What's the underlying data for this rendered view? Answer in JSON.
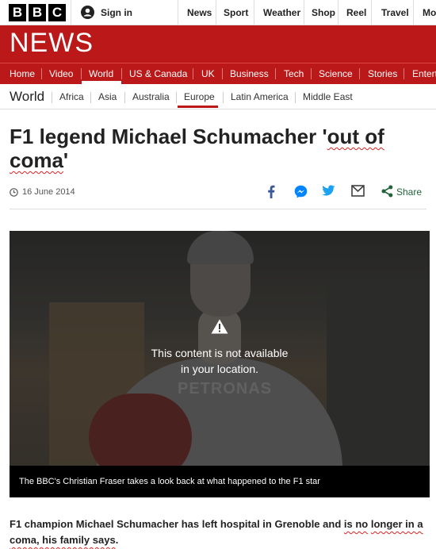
{
  "brand": {
    "letters": [
      "B",
      "B",
      "C"
    ]
  },
  "account": {
    "signin_label": "Sign in",
    "icon": "user-icon"
  },
  "top_nav": [
    "News",
    "Sport",
    "Weather",
    "Shop",
    "Reel",
    "Travel",
    "Mo"
  ],
  "banner": {
    "title": "NEWS",
    "color": "#bb1919"
  },
  "main_nav": {
    "items": [
      "Home",
      "Video",
      "World",
      "US & Canada",
      "UK",
      "Business",
      "Tech",
      "Science",
      "Stories",
      "Entert"
    ],
    "active": "World"
  },
  "section_nav": {
    "title": "World",
    "items": [
      "Africa",
      "Asia",
      "Australia",
      "Europe",
      "Latin America",
      "Middle East"
    ],
    "active": "Europe"
  },
  "article": {
    "headline_part1": "F1 legend Michael Schumacher '",
    "headline_underlined_1": "out of",
    "headline_break": " ",
    "headline_underlined_2": "coma",
    "headline_part2": "'",
    "date": "16 June 2014",
    "share_label": "Share",
    "share_icons": [
      "facebook-icon",
      "messenger-icon",
      "twitter-icon",
      "email-icon",
      "share-icon"
    ]
  },
  "media": {
    "notice_line1": "This content is not available",
    "notice_line2": "in your location.",
    "background_text": "PETRONAS",
    "caption": "The BBC's Christian Fraser takes a look back at what happened to the F1 star"
  },
  "body": {
    "para1_plain": "F1 champion Michael Schumacher has left hospital in Grenoble and ",
    "para1_underlined_a": "is no",
    "para1_break": " ",
    "para1_underlined_b": "longer in a coma, his family says",
    "para1_end": "."
  }
}
